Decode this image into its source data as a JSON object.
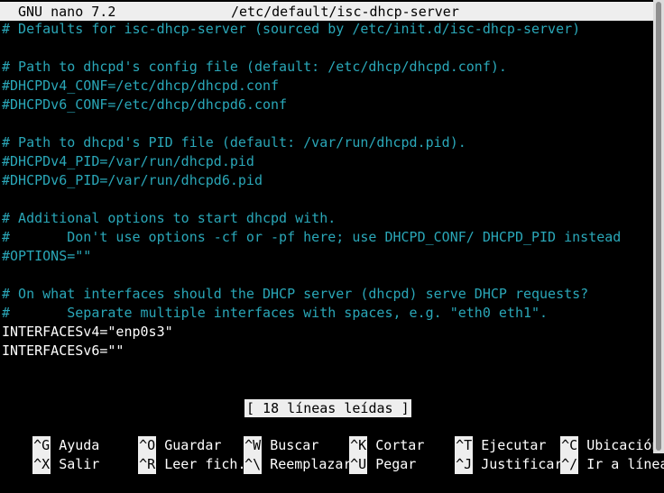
{
  "titlebar": {
    "app": "GNU nano 7.2",
    "file": "/etc/default/isc-dhcp-server"
  },
  "lines": [
    "# Defaults for isc-dhcp-server (sourced by /etc/init.d/isc-dhcp-server)",
    "",
    "# Path to dhcpd's config file (default: /etc/dhcp/dhcpd.conf).",
    "#DHCPDv4_CONF=/etc/dhcp/dhcpd.conf",
    "#DHCPDv6_CONF=/etc/dhcp/dhcpd6.conf",
    "",
    "# Path to dhcpd's PID file (default: /var/run/dhcpd.pid).",
    "#DHCPDv4_PID=/var/run/dhcpd.pid",
    "#DHCPDv6_PID=/var/run/dhcpd6.pid",
    "",
    "# Additional options to start dhcpd with.",
    "#       Don't use options -cf or -pf here; use DHCPD_CONF/ DHCPD_PID instead",
    "#OPTIONS=\"\"",
    "",
    "# On what interfaces should the DHCP server (dhcpd) serve DHCP requests?",
    "#       Separate multiple interfaces with spaces, e.g. \"eth0 eth1\".",
    "INTERFACESv4=\"enp0s3\"",
    "INTERFACESv6=\"\""
  ],
  "status": "[ 18 líneas leídas ]",
  "shortcuts": [
    {
      "key": "^G",
      "label": "Ayuda"
    },
    {
      "key": "^O",
      "label": "Guardar"
    },
    {
      "key": "^W",
      "label": "Buscar"
    },
    {
      "key": "^K",
      "label": "Cortar"
    },
    {
      "key": "^T",
      "label": "Ejecutar"
    },
    {
      "key": "^C",
      "label": "Ubicación"
    },
    {
      "key": "^X",
      "label": "Salir"
    },
    {
      "key": "^R",
      "label": "Leer fich."
    },
    {
      "key": "^\\",
      "label": "Reemplazar"
    },
    {
      "key": "^U",
      "label": "Pegar"
    },
    {
      "key": "^J",
      "label": "Justificar"
    },
    {
      "key": "^/",
      "label": "Ir a línea"
    }
  ],
  "colors": {
    "comment": "#2aa7b8",
    "text": "#ffffff",
    "background": "#000000",
    "bar": "#eeeeee"
  }
}
